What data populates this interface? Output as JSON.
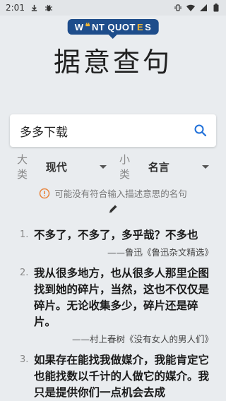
{
  "status_bar": {
    "time": "2:01",
    "icons_left": [
      "download-icon",
      "bug-icon"
    ],
    "icons_right": [
      "vibrate-icon",
      "wifi-icon",
      "signal-icon",
      "battery-icon"
    ]
  },
  "logo": {
    "part1": "W",
    "part2": "NT QUOT",
    "part3": "S"
  },
  "title": "据意查句",
  "search": {
    "value": "多多下载",
    "placeholder": ""
  },
  "filters": {
    "category_label": "大类",
    "category_value": "现代",
    "subcategory_label": "小类",
    "subcategory_value": "名言"
  },
  "notice": "可能没有符合输入描述意思的名句",
  "quotes": [
    {
      "num": "1.",
      "text": "不多了，不多了，多乎哉？不多也",
      "source": "——鲁迅《鲁迅杂文精选》"
    },
    {
      "num": "2.",
      "text": "我从很多地方，也从很多人那里企图找到她的碎片，当然，这也不仅仅是碎片。无论收集多少，碎片还是碎片。",
      "source": "——村上春树《没有女人的男人们》"
    },
    {
      "num": "3.",
      "text": "如果存在能找我做媒介，我能肯定它也能找数以千计的人做它的媒介。我只是提供你们一点机会去成",
      "source": ""
    }
  ],
  "colors": {
    "accent": "#1e6fd9",
    "warning": "#e8833a",
    "logo_bg": "#1e4d8b"
  }
}
